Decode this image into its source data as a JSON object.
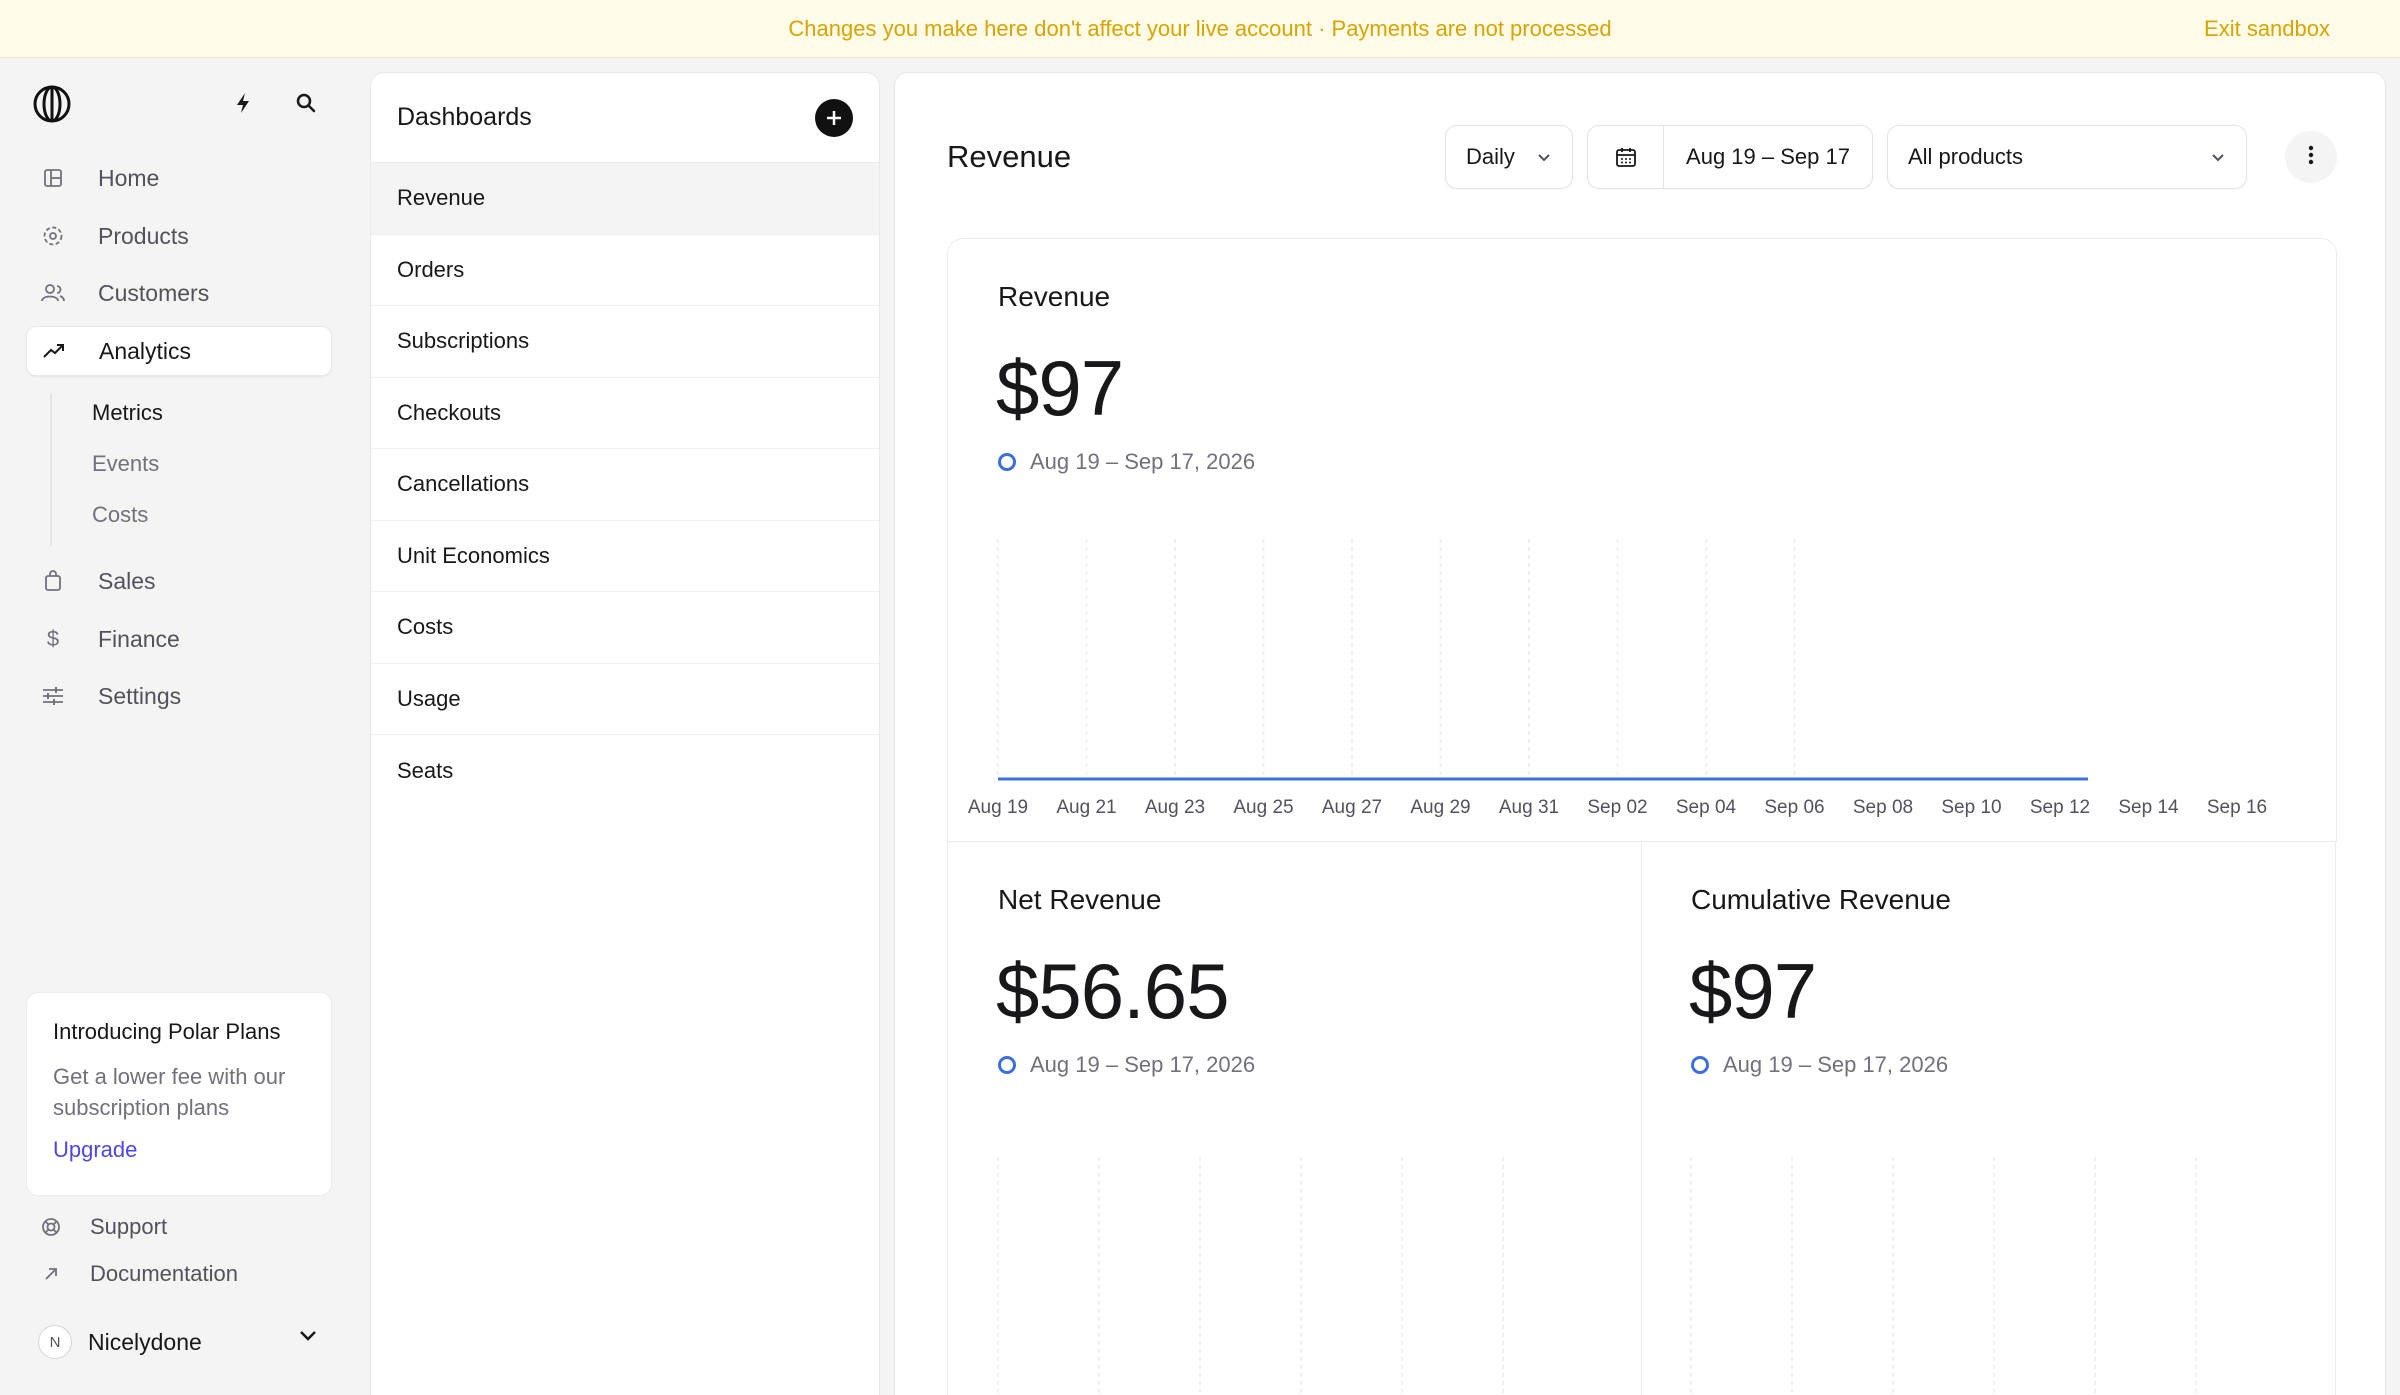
{
  "banner": {
    "message": "Changes you make here don't affect your live account · Payments are not processed",
    "exit_label": "Exit sandbox"
  },
  "sidebar": {
    "nav": [
      {
        "label": "Home",
        "icon": "home-icon"
      },
      {
        "label": "Products",
        "icon": "products-icon"
      },
      {
        "label": "Customers",
        "icon": "customers-icon"
      },
      {
        "label": "Analytics",
        "icon": "analytics-icon",
        "active": true
      },
      {
        "label": "Sales",
        "icon": "sales-icon"
      },
      {
        "label": "Finance",
        "icon": "dollar-icon"
      },
      {
        "label": "Settings",
        "icon": "settings-icon"
      }
    ],
    "subnav": [
      {
        "label": "Metrics",
        "active": true
      },
      {
        "label": "Events"
      },
      {
        "label": "Costs"
      }
    ],
    "promo": {
      "title": "Introducing Polar Plans",
      "text": "Get a lower fee with our subscription plans",
      "link": "Upgrade"
    },
    "footer": [
      {
        "label": "Support",
        "icon": "support-icon"
      },
      {
        "label": "Documentation",
        "icon": "arrow-up-right-icon"
      }
    ],
    "user": {
      "initial": "N",
      "name": "Nicelydone"
    }
  },
  "dashboards": {
    "title": "Dashboards",
    "items": [
      "Revenue",
      "Orders",
      "Subscriptions",
      "Checkouts",
      "Cancellations",
      "Unit Economics",
      "Costs",
      "Usage",
      "Seats"
    ],
    "active": "Revenue"
  },
  "main": {
    "title": "Revenue",
    "interval": "Daily",
    "date_range": "Aug 19 – Sep 17",
    "product_filter": "All products",
    "accent": "#3b6fe0"
  },
  "metrics": {
    "revenue": {
      "title": "Revenue",
      "value": "$97",
      "range": "Aug 19 – Sep 17, 2026"
    },
    "net_revenue": {
      "title": "Net Revenue",
      "value": "$56.65",
      "range": "Aug 19 – Sep 17, 2026"
    },
    "cumulative_revenue": {
      "title": "Cumulative Revenue",
      "value": "$97",
      "range": "Aug 19 – Sep 17, 2026"
    }
  },
  "chart_data": [
    {
      "type": "line",
      "title": "Revenue",
      "x_ticks": [
        "Aug 19",
        "Aug 21",
        "Aug 23",
        "Aug 25",
        "Aug 27",
        "Aug 29",
        "Aug 31",
        "Sep 02",
        "Sep 04",
        "Sep 06",
        "Sep 08",
        "Sep 10",
        "Sep 12",
        "Sep 14",
        "Sep 16"
      ],
      "series": [
        {
          "values": [
            0,
            0,
            0,
            0,
            0,
            0,
            0,
            0,
            0,
            0,
            0,
            0,
            0,
            0,
            0,
            0,
            0,
            0,
            0,
            0,
            0,
            0,
            0,
            0,
            0,
            0
          ]
        }
      ],
      "grid": true
    },
    {
      "type": "line",
      "title": "Net Revenue",
      "series": [
        {
          "values": [
            0,
            0,
            0,
            0,
            0,
            0
          ]
        }
      ],
      "grid": true
    },
    {
      "type": "line",
      "title": "Cumulative Revenue",
      "series": [
        {
          "values": [
            0,
            0,
            0,
            0,
            0,
            0
          ]
        }
      ],
      "grid": true
    }
  ]
}
